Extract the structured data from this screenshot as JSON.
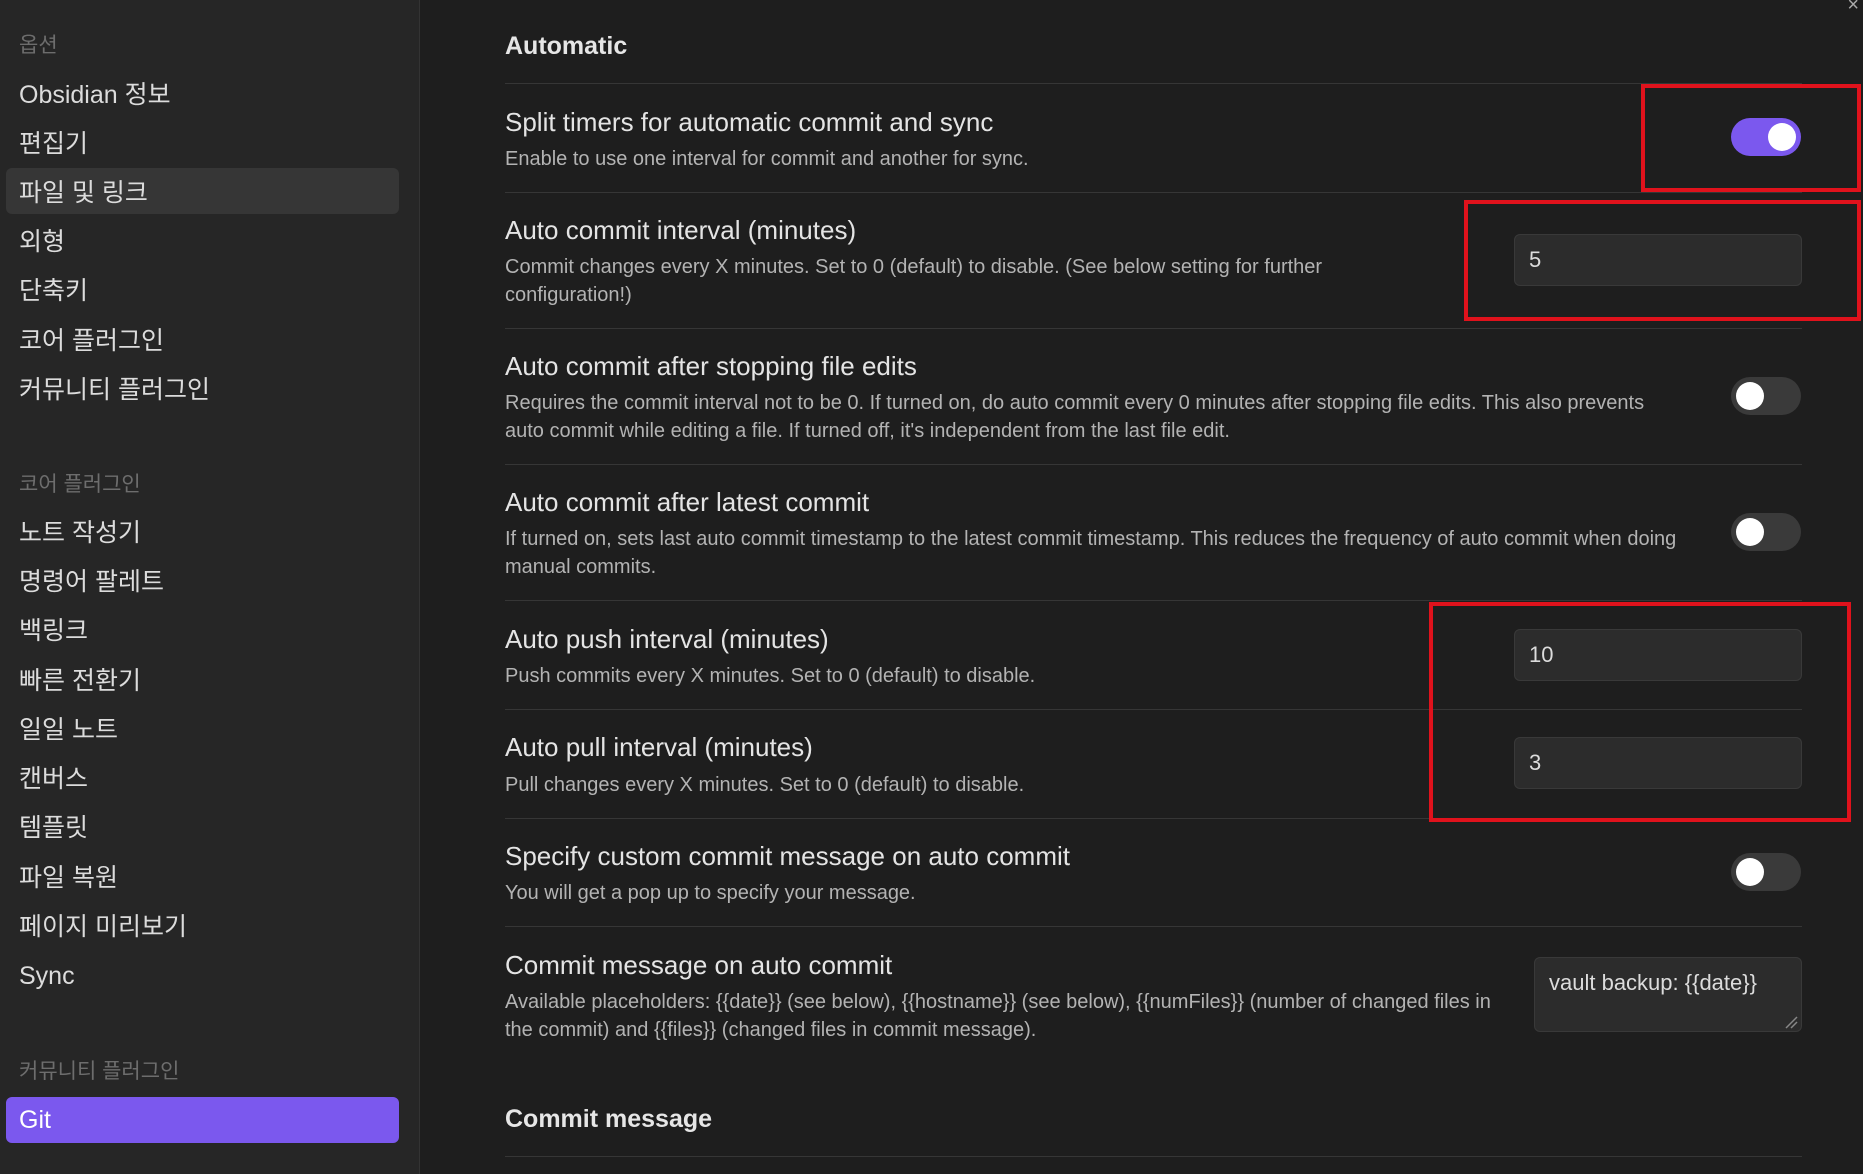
{
  "sidebar": {
    "options_title": "옵션",
    "options_items": [
      "Obsidian 정보",
      "편집기",
      "파일 및 링크",
      "외형",
      "단축키",
      "코어 플러그인",
      "커뮤니티 플러그인"
    ],
    "core_title": "코어 플러그인",
    "core_items": [
      "노트 작성기",
      "명령어 팔레트",
      "백링크",
      "빠른 전환기",
      "일일 노트",
      "캔버스",
      "템플릿",
      "파일 복원",
      "페이지 미리보기",
      "Sync"
    ],
    "community_title": "커뮤니티 플러그인",
    "community_items": [
      "Git"
    ]
  },
  "main": {
    "automatic_heading": "Automatic",
    "settings": [
      {
        "name": "Split timers for automatic commit and sync",
        "desc": "Enable to use one interval for commit and another for sync.",
        "toggle": true
      },
      {
        "name": "Auto commit interval (minutes)",
        "desc": "Commit changes every X minutes. Set to 0 (default) to disable. (See below setting for further configuration!)",
        "value": "5"
      },
      {
        "name": "Auto commit after stopping file edits",
        "desc": "Requires the commit interval not to be 0. If turned on, do auto commit every 0 minutes after stopping file edits. This also prevents auto commit while editing a file. If turned off, it's independent from the last file edit.",
        "toggle": false
      },
      {
        "name": "Auto commit after latest commit",
        "desc": "If turned on, sets last auto commit timestamp to the latest commit timestamp. This reduces the frequency of auto commit when doing manual commits.",
        "toggle": false
      },
      {
        "name": "Auto push interval (minutes)",
        "desc": "Push commits every X minutes. Set to 0 (default) to disable.",
        "value": "10"
      },
      {
        "name": "Auto pull interval (minutes)",
        "desc": "Pull changes every X minutes. Set to 0 (default) to disable.",
        "value": "3"
      },
      {
        "name": "Specify custom commit message on auto commit",
        "desc": "You will get a pop up to specify your message.",
        "toggle": false
      },
      {
        "name": "Commit message on auto commit",
        "desc": "Available placeholders: {{date}} (see below), {{hostname}} (see below), {{numFiles}} (number of changed files in the commit) and {{files}} (changed files in commit message).",
        "value": "vault backup: {{date}}"
      }
    ],
    "commit_message_heading": "Commit message"
  },
  "colors": {
    "accent": "#7b58ee",
    "highlight": "#e0121c",
    "background": "#1e1e1e",
    "sidebar": "#262626"
  }
}
